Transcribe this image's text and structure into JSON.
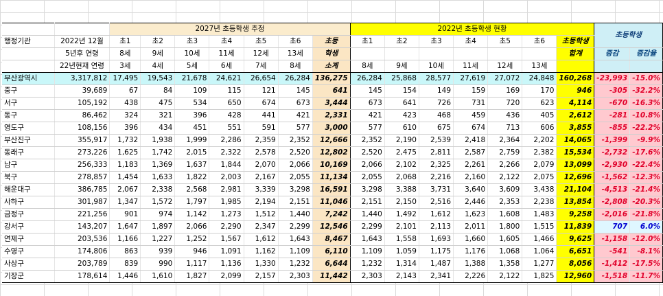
{
  "header": {
    "row1": {
      "group2027": "2027년 초등학생 추정",
      "group2022": "2022년 초등학생 현황",
      "groupChange": "초등학생"
    },
    "row2": {
      "agency": "행정기관",
      "basis": "2022년 12월",
      "grades27": [
        "초1",
        "초2",
        "초3",
        "초4",
        "초5",
        "초6"
      ],
      "subtotal": "초등",
      "grades22": [
        "초1",
        "초2",
        "초3",
        "초4",
        "초5",
        "초6"
      ],
      "total22": "초등학생"
    },
    "row3": {
      "basis": "5년후 연령",
      "ages27": [
        "8세",
        "9세",
        "10세",
        "11세",
        "12세",
        "13세"
      ],
      "subtotal": "학생",
      "total22": "합계",
      "change": "증감",
      "changeRate": "증감율"
    },
    "row4": {
      "basis": "22년현재 연령",
      "ages27": [
        "3세",
        "4세",
        "5세",
        "6세",
        "7세",
        "8세"
      ],
      "subtotal": "소계",
      "ages22": [
        "8세",
        "9세",
        "10세",
        "11세",
        "12세",
        "13세"
      ]
    }
  },
  "rows": [
    {
      "name": "부산광역시",
      "pop": "3,317,812",
      "e27": [
        "17,495",
        "19,543",
        "21,678",
        "24,621",
        "26,654",
        "26,284"
      ],
      "sub27": "136,275",
      "e22": [
        "26,284",
        "25,868",
        "28,577",
        "27,619",
        "27,072",
        "24,848"
      ],
      "tot22": "160,268",
      "diff": "-23,993",
      "rate": "-15.0%",
      "sign": "neg"
    },
    {
      "name": "중구",
      "pop": "39,689",
      "e27": [
        "67",
        "84",
        "109",
        "115",
        "121",
        "145"
      ],
      "sub27": "641",
      "e22": [
        "145",
        "154",
        "149",
        "159",
        "169",
        "170"
      ],
      "tot22": "946",
      "diff": "-305",
      "rate": "-32.2%",
      "sign": "neg"
    },
    {
      "name": "서구",
      "pop": "105,192",
      "e27": [
        "438",
        "475",
        "534",
        "650",
        "674",
        "673"
      ],
      "sub27": "3,444",
      "e22": [
        "673",
        "641",
        "726",
        "731",
        "720",
        "623"
      ],
      "tot22": "4,114",
      "diff": "-670",
      "rate": "-16.3%",
      "sign": "neg"
    },
    {
      "name": "동구",
      "pop": "86,462",
      "e27": [
        "324",
        "321",
        "396",
        "428",
        "441",
        "421"
      ],
      "sub27": "2,331",
      "e22": [
        "421",
        "423",
        "468",
        "459",
        "436",
        "405"
      ],
      "tot22": "2,612",
      "diff": "-281",
      "rate": "-10.8%",
      "sign": "neg"
    },
    {
      "name": "영도구",
      "pop": "108,156",
      "e27": [
        "396",
        "434",
        "451",
        "551",
        "591",
        "577"
      ],
      "sub27": "3,000",
      "e22": [
        "577",
        "610",
        "675",
        "674",
        "713",
        "606"
      ],
      "tot22": "3,855",
      "diff": "-855",
      "rate": "-22.2%",
      "sign": "neg"
    },
    {
      "name": "부산진구",
      "pop": "355,917",
      "e27": [
        "1,732",
        "1,938",
        "1,999",
        "2,286",
        "2,359",
        "2,352"
      ],
      "sub27": "12,666",
      "e22": [
        "2,352",
        "2,190",
        "2,539",
        "2,418",
        "2,364",
        "2,202"
      ],
      "tot22": "14,065",
      "diff": "-1,399",
      "rate": "-9.9%",
      "sign": "neg"
    },
    {
      "name": "동래구",
      "pop": "273,226",
      "e27": [
        "1,625",
        "1,742",
        "2,015",
        "2,322",
        "2,578",
        "2,520"
      ],
      "sub27": "12,802",
      "e22": [
        "2,520",
        "2,475",
        "2,811",
        "2,587",
        "2,759",
        "2,382"
      ],
      "tot22": "15,534",
      "diff": "-2,732",
      "rate": "-17.6%",
      "sign": "neg"
    },
    {
      "name": "남구",
      "pop": "256,333",
      "e27": [
        "1,183",
        "1,369",
        "1,637",
        "1,844",
        "2,070",
        "2,066"
      ],
      "sub27": "10,169",
      "e22": [
        "2,066",
        "2,102",
        "2,325",
        "2,261",
        "2,266",
        "2,079"
      ],
      "tot22": "13,099",
      "diff": "-2,930",
      "rate": "-22.4%",
      "sign": "neg"
    },
    {
      "name": "북구",
      "pop": "278,857",
      "e27": [
        "1,454",
        "1,633",
        "1,822",
        "2,003",
        "2,167",
        "2,055"
      ],
      "sub27": "11,134",
      "e22": [
        "2,055",
        "2,068",
        "2,216",
        "2,160",
        "2,122",
        "2,075"
      ],
      "tot22": "12,696",
      "diff": "-1,562",
      "rate": "-12.3%",
      "sign": "neg"
    },
    {
      "name": "해운대구",
      "pop": "386,785",
      "e27": [
        "2,067",
        "2,338",
        "2,568",
        "2,981",
        "3,339",
        "3,298"
      ],
      "sub27": "16,591",
      "e22": [
        "3,298",
        "3,388",
        "3,731",
        "3,640",
        "3,609",
        "3,438"
      ],
      "tot22": "21,104",
      "diff": "-4,513",
      "rate": "-21.4%",
      "sign": "neg"
    },
    {
      "name": "사하구",
      "pop": "301,987",
      "e27": [
        "1,347",
        "1,572",
        "1,797",
        "1,985",
        "2,194",
        "2,151"
      ],
      "sub27": "11,046",
      "e22": [
        "2,151",
        "2,150",
        "2,516",
        "2,446",
        "2,353",
        "2,238"
      ],
      "tot22": "13,854",
      "diff": "-2,808",
      "rate": "-20.3%",
      "sign": "neg"
    },
    {
      "name": "금정구",
      "pop": "221,256",
      "e27": [
        "901",
        "974",
        "1,142",
        "1,273",
        "1,512",
        "1,440"
      ],
      "sub27": "7,242",
      "e22": [
        "1,440",
        "1,492",
        "1,612",
        "1,623",
        "1,608",
        "1,483"
      ],
      "tot22": "9,258",
      "diff": "-2,016",
      "rate": "-21.8%",
      "sign": "neg"
    },
    {
      "name": "강서구",
      "pop": "143,207",
      "e27": [
        "1,647",
        "1,897",
        "2,066",
        "2,290",
        "2,347",
        "2,299"
      ],
      "sub27": "12,546",
      "e22": [
        "2,299",
        "2,101",
        "2,113",
        "2,011",
        "1,800",
        "1,515"
      ],
      "tot22": "11,839",
      "diff": "707",
      "rate": "6.0%",
      "sign": "pos"
    },
    {
      "name": "연제구",
      "pop": "203,536",
      "e27": [
        "1,166",
        "1,227",
        "1,252",
        "1,567",
        "1,612",
        "1,643"
      ],
      "sub27": "8,467",
      "e22": [
        "1,643",
        "1,558",
        "1,693",
        "1,660",
        "1,605",
        "1,466"
      ],
      "tot22": "9,625",
      "diff": "-1,158",
      "rate": "-12.0%",
      "sign": "neg"
    },
    {
      "name": "수영구",
      "pop": "174,806",
      "e27": [
        "863",
        "939",
        "946",
        "1,091",
        "1,162",
        "1,109"
      ],
      "sub27": "6,110",
      "e22": [
        "1,109",
        "1,059",
        "1,175",
        "1,176",
        "1,068",
        "1,064"
      ],
      "tot22": "6,651",
      "diff": "-541",
      "rate": "-8.1%",
      "sign": "neg"
    },
    {
      "name": "사상구",
      "pop": "203,789",
      "e27": [
        "839",
        "990",
        "1,117",
        "1,136",
        "1,330",
        "1,232"
      ],
      "sub27": "6,644",
      "e22": [
        "1,232",
        "1,314",
        "1,487",
        "1,388",
        "1,358",
        "1,277"
      ],
      "tot22": "8,056",
      "diff": "-1,412",
      "rate": "-17.5%",
      "sign": "neg"
    },
    {
      "name": "기장군",
      "pop": "178,614",
      "e27": [
        "1,446",
        "1,610",
        "1,827",
        "2,099",
        "2,157",
        "2,303"
      ],
      "sub27": "11,442",
      "e22": [
        "2,303",
        "2,143",
        "2,341",
        "2,226",
        "2,122",
        "1,825"
      ],
      "tot22": "12,960",
      "diff": "-1,518",
      "rate": "-11.7%",
      "sign": "neg"
    }
  ]
}
